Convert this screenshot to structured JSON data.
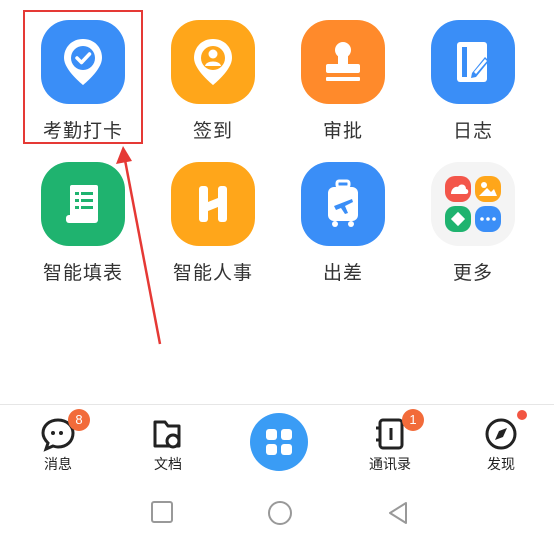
{
  "apps": [
    {
      "label": "考勤打卡",
      "icon": "attendance-location-check-icon",
      "color": "#3a8ef7"
    },
    {
      "label": "签到",
      "icon": "sign-in-location-icon",
      "color": "#ffa61a"
    },
    {
      "label": "审批",
      "icon": "approval-stamp-icon",
      "color": "#ff8a2b"
    },
    {
      "label": "日志",
      "icon": "log-notebook-icon",
      "color": "#3a8ef7"
    },
    {
      "label": "智能填表",
      "icon": "smart-form-scroll-icon",
      "color": "#1fb36f"
    },
    {
      "label": "智能人事",
      "icon": "smart-hr-h-icon",
      "color": "#ffa61a"
    },
    {
      "label": "出差",
      "icon": "business-trip-luggage-icon",
      "color": "#3a8ef7"
    },
    {
      "label": "更多",
      "icon": "more-apps-grid-icon",
      "color": "#f2f2f2"
    }
  ],
  "tabbar": {
    "messages": {
      "label": "消息",
      "badge": "8"
    },
    "docs": {
      "label": "文档"
    },
    "contacts": {
      "label": "通讯录",
      "badge": "1"
    },
    "discover": {
      "label": "发现"
    }
  },
  "colors": {
    "highlight": "#e53935",
    "accent": "#3a9cf5",
    "badge": "#f26b3a"
  }
}
